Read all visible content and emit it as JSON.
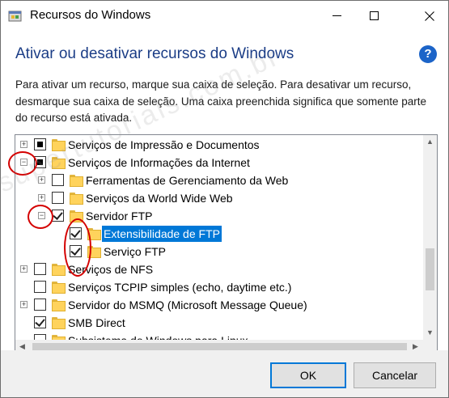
{
  "window": {
    "title": "Recursos do Windows"
  },
  "heading": "Ativar ou desativar recursos do Windows",
  "description": "Para ativar um recurso, marque sua caixa de seleção. Para desativar um recurso, desmarque sua caixa de seleção. Uma caixa preenchida significa que somente parte do recurso está ativada.",
  "tree": [
    {
      "label": "Serviços de Impressão e Documentos",
      "expander": "+",
      "state": "partial",
      "level": 0
    },
    {
      "label": "Serviços de Informações da Internet",
      "expander": "−",
      "state": "partial",
      "level": 0
    },
    {
      "label": "Ferramentas de Gerenciamento da Web",
      "expander": "+",
      "state": "unchecked",
      "level": 1
    },
    {
      "label": "Serviços da World Wide Web",
      "expander": "+",
      "state": "unchecked",
      "level": 1
    },
    {
      "label": "Servidor FTP",
      "expander": "−",
      "state": "checked",
      "level": 1
    },
    {
      "label": "Extensibilidade de FTP",
      "expander": "",
      "state": "checked",
      "level": 2,
      "selected": true
    },
    {
      "label": "Serviço FTP",
      "expander": "",
      "state": "checked",
      "level": 2
    },
    {
      "label": "Serviços de NFS",
      "expander": "+",
      "state": "unchecked",
      "level": 0
    },
    {
      "label": "Serviços TCPIP simples (echo, daytime etc.)",
      "expander": "",
      "state": "unchecked",
      "level": 0
    },
    {
      "label": "Servidor do MSMQ (Microsoft Message Queue)",
      "expander": "+",
      "state": "unchecked",
      "level": 0
    },
    {
      "label": "SMB Direct",
      "expander": "",
      "state": "checked",
      "level": 0
    },
    {
      "label": "Subsistema do Windows para Linux",
      "expander": "",
      "state": "unchecked",
      "level": 0
    }
  ],
  "buttons": {
    "ok": "OK",
    "cancel": "Cancelar"
  },
  "watermark": "supertutoriais.com.br",
  "colors": {
    "heading": "#1b3d86",
    "selection": "#0078d7",
    "annotation": "#d40000",
    "help": "#1c64c8"
  }
}
